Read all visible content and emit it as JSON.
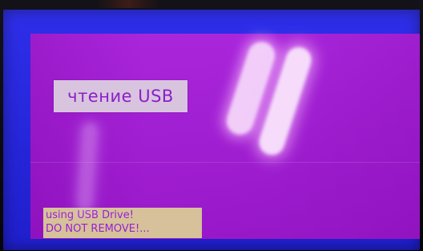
{
  "screen": {
    "status_label": "чтение USB",
    "warning": {
      "line1": "using USB Drive!",
      "line2": "DO NOT REMOVE!..."
    }
  },
  "colors": {
    "bezel": "#2323e8",
    "screen_background": "#a41ad9",
    "status_box": "#d9c4df",
    "status_text": "#8a20c8",
    "warning_box": "#d6c19a",
    "warning_text": "#9a1fd4"
  }
}
